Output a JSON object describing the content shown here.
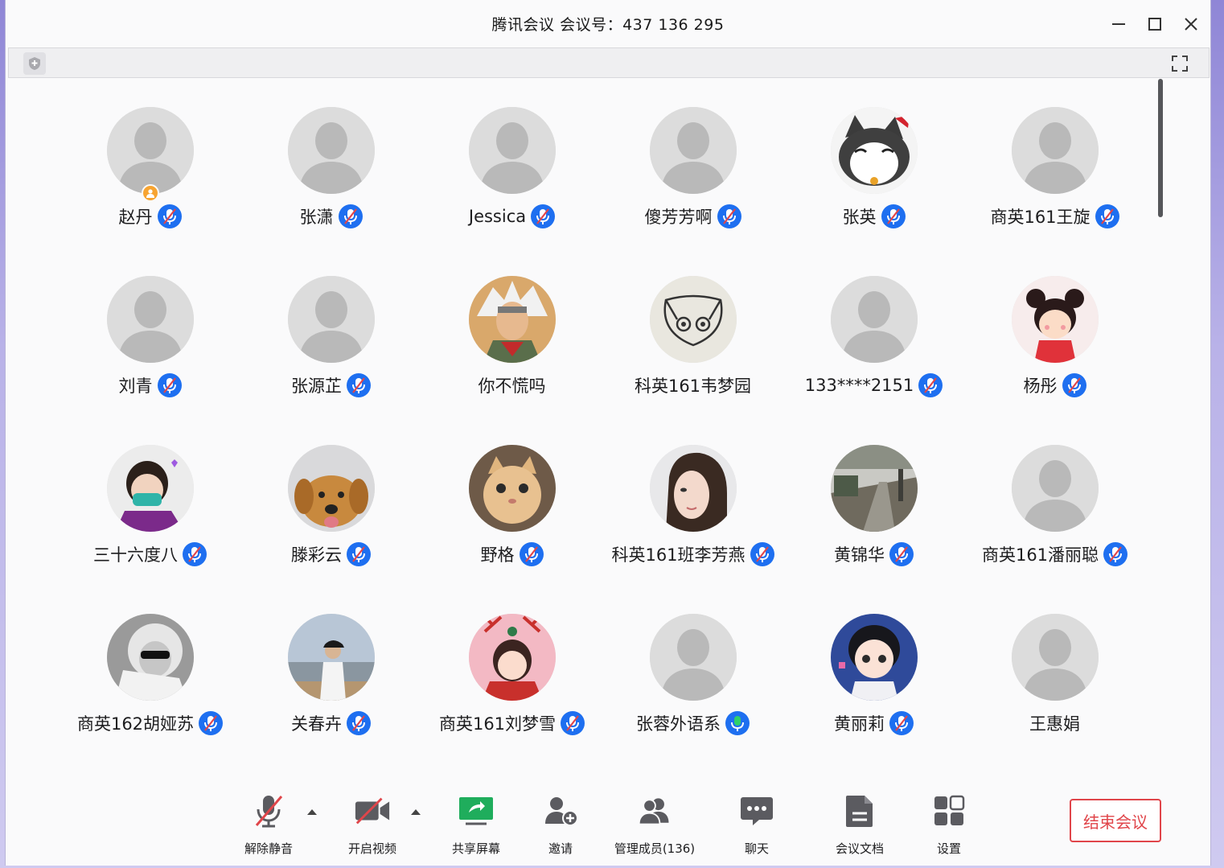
{
  "window": {
    "title": "腾讯会议 会议号：437 136 295"
  },
  "participants": [
    {
      "name": "赵丹",
      "avatar": "default",
      "mic": "muted",
      "host": true
    },
    {
      "name": "张潇",
      "avatar": "default",
      "mic": "muted"
    },
    {
      "name": "Jessica",
      "avatar": "default",
      "mic": "muted"
    },
    {
      "name": "傻芳芳啊",
      "avatar": "default",
      "mic": "muted"
    },
    {
      "name": "张英",
      "avatar": "cat-cartoon",
      "mic": "muted"
    },
    {
      "name": "商英161王旋",
      "avatar": "default",
      "mic": "muted"
    },
    {
      "name": "刘青",
      "avatar": "default",
      "mic": "muted"
    },
    {
      "name": "张源芷",
      "avatar": "default",
      "mic": "muted"
    },
    {
      "name": "你不慌吗",
      "avatar": "anime-character",
      "mic": "none"
    },
    {
      "name": "科英161韦梦园",
      "avatar": "cat-drawing",
      "mic": "none"
    },
    {
      "name": "133****2151",
      "avatar": "default",
      "mic": "muted"
    },
    {
      "name": "杨彤",
      "avatar": "girl-cartoon",
      "mic": "muted"
    },
    {
      "name": "三十六度八",
      "avatar": "child-photo",
      "mic": "muted"
    },
    {
      "name": "滕彩云",
      "avatar": "dog-photo",
      "mic": "muted"
    },
    {
      "name": "野格",
      "avatar": "cat-photo",
      "mic": "muted"
    },
    {
      "name": "科英161班李芳燕",
      "avatar": "woman-photo",
      "mic": "muted"
    },
    {
      "name": "黄锦华",
      "avatar": "street-photo",
      "mic": "muted"
    },
    {
      "name": "商英161潘丽聪",
      "avatar": "default",
      "mic": "muted"
    },
    {
      "name": "商英162胡娅苏",
      "avatar": "bw-photo",
      "mic": "muted"
    },
    {
      "name": "关春卉",
      "avatar": "beach-photo",
      "mic": "muted"
    },
    {
      "name": "商英161刘梦雪",
      "avatar": "festive-photo",
      "mic": "muted"
    },
    {
      "name": "张蓉外语系",
      "avatar": "default",
      "mic": "live"
    },
    {
      "name": "黄丽莉",
      "avatar": "boy-cartoon",
      "mic": "muted"
    },
    {
      "name": "王惠娟",
      "avatar": "default",
      "mic": "none"
    }
  ],
  "bottom_bar": {
    "unmute": "解除静音",
    "video": "开启视频",
    "share": "共享屏幕",
    "invite": "邀请",
    "members": "管理成员(136)",
    "chat": "聊天",
    "docs": "会议文档",
    "settings": "设置",
    "end": "结束会议"
  },
  "colors": {
    "accent": "#1e6ff0",
    "end_red": "#e0454a",
    "share_green": "#1fad5c",
    "host_badge": "#f7a431"
  }
}
